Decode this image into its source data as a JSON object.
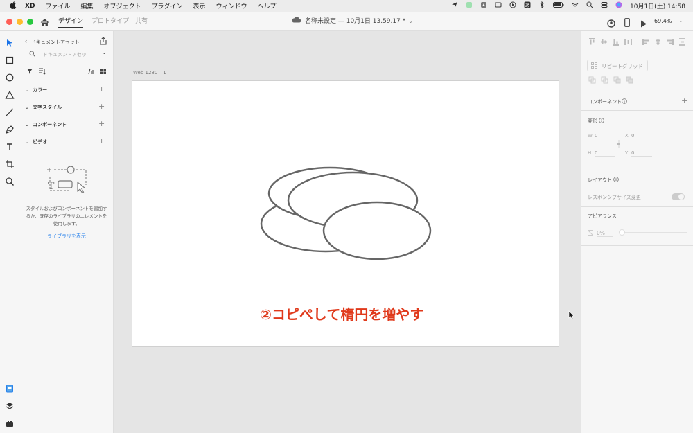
{
  "menubar": {
    "app_name": "XD",
    "items": [
      "ファイル",
      "編集",
      "オブジェクト",
      "プラグイン",
      "表示",
      "ウィンドウ",
      "ヘルプ"
    ],
    "clock": "10月1日(土)  14:58"
  },
  "titlebar": {
    "tabs": [
      "デザイン",
      "プロトタイプ",
      "共有"
    ],
    "active_tab": "デザイン",
    "doc_title": "名称未設定 — 10月1日 13.59.17 *",
    "zoom": "69.4%"
  },
  "assets": {
    "header": "ドキュメントアセット",
    "search_placeholder": "ドキュメントアセッ",
    "sections": [
      "カラー",
      "文字スタイル",
      "コンポーネント",
      "ビデオ"
    ],
    "empty_text_1": "スタイルおよびコンポーネントを追加す",
    "empty_text_2": "るか、既存のライブラリのエレメントを",
    "empty_text_3": "使用します。",
    "library_link": "ライブラリを表示"
  },
  "canvas": {
    "artboard_label": "Web 1280 – 1",
    "caption": "②コピペして楕円を増やす"
  },
  "props": {
    "repeat_grid": "リピートグリッド",
    "component": "コンポーネント",
    "transform": "変形",
    "w_label": "W",
    "w_value": "0",
    "x_label": "X",
    "x_value": "0",
    "h_label": "H",
    "h_value": "0",
    "y_label": "Y",
    "y_value": "0",
    "layout": "レイアウト",
    "responsive": "レスポンシブサイズ変更",
    "appearance": "アピアランス",
    "opacity": "0%"
  },
  "colors": {
    "accent": "#2680eb",
    "caption": "#e0391b",
    "close": "#ff5f57",
    "minimize": "#febc2e",
    "maximize": "#28c840"
  }
}
